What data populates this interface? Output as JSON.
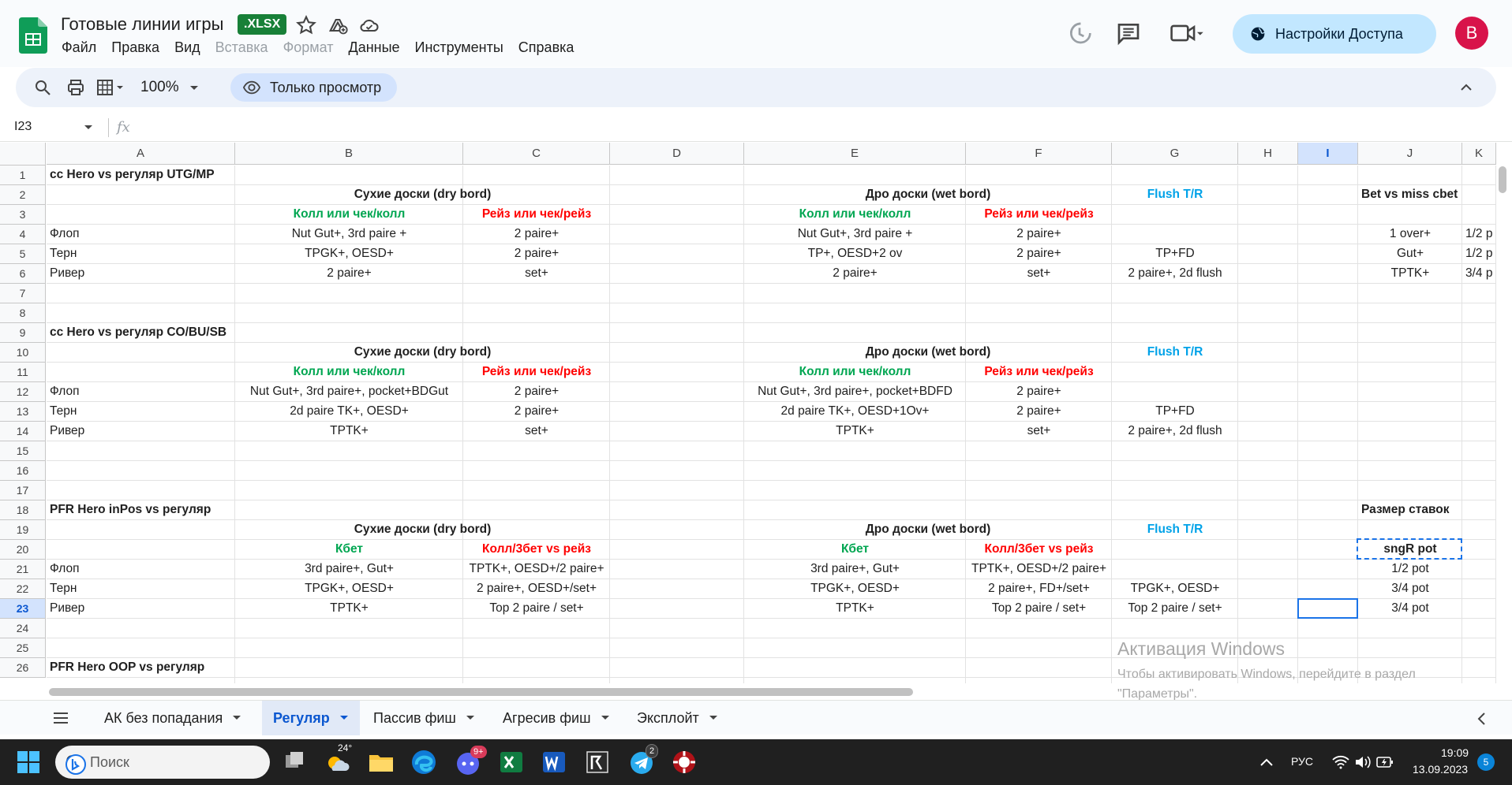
{
  "doc": {
    "title": "Готовые линии игры",
    "format_badge": ".XLSX"
  },
  "menu": [
    "Файл",
    "Правка",
    "Вид",
    "Вставка",
    "Формат",
    "Данные",
    "Инструменты",
    "Справка"
  ],
  "menu_disabled": [
    "Вставка",
    "Формат"
  ],
  "share_label": "Настройки Доступа",
  "avatar_letter": "B",
  "toolbar": {
    "zoom": "100%",
    "view_only": "Только просмотр"
  },
  "formula_bar": {
    "name_box": "I23",
    "fx_label": "fx"
  },
  "columns": [
    "A",
    "B",
    "C",
    "D",
    "E",
    "F",
    "G",
    "H",
    "I",
    "J",
    "K"
  ],
  "selected_column": "I",
  "rows": [
    "1",
    "2",
    "3",
    "4",
    "5",
    "6",
    "7",
    "8",
    "9",
    "10",
    "11",
    "12",
    "13",
    "14",
    "15",
    "16",
    "17",
    "18",
    "19",
    "20",
    "21",
    "22",
    "23",
    "24",
    "25",
    "26"
  ],
  "selected_row": "23",
  "cells": [
    {
      "ref": "A1",
      "text": "cc Hero vs регуляр UTG/MP",
      "style": "b"
    },
    {
      "ref": "B2",
      "text": "Сухие доски (dry bord)",
      "style": "b",
      "span": 2
    },
    {
      "ref": "E2",
      "text": "Дро доски (wet bord)",
      "style": "b",
      "span": 2
    },
    {
      "ref": "G2",
      "text": "Flush T/R",
      "style": "blue"
    },
    {
      "ref": "J2",
      "text": "Bet vs miss cbet",
      "style": "b",
      "align": "left"
    },
    {
      "ref": "B3",
      "text": "Колл или чек/колл",
      "style": "green"
    },
    {
      "ref": "C3",
      "text": "Рейз или чек/рейз",
      "style": "red"
    },
    {
      "ref": "E3",
      "text": "Колл или чек/колл",
      "style": "green"
    },
    {
      "ref": "F3",
      "text": "Рейз или чек/рейз",
      "style": "red"
    },
    {
      "ref": "A4",
      "text": "Флоп",
      "style": "",
      "align": "left"
    },
    {
      "ref": "B4",
      "text": "Nut Gut+, 3rd paire +"
    },
    {
      "ref": "C4",
      "text": "2 paire+"
    },
    {
      "ref": "E4",
      "text": "Nut Gut+, 3rd paire +"
    },
    {
      "ref": "F4",
      "text": "2 paire+"
    },
    {
      "ref": "J4",
      "text": "1 over+"
    },
    {
      "ref": "K4",
      "text": "1/2 р",
      "align": "left"
    },
    {
      "ref": "A5",
      "text": "Терн",
      "align": "left"
    },
    {
      "ref": "B5",
      "text": "TPGK+, OESD+"
    },
    {
      "ref": "C5",
      "text": "2 paire+"
    },
    {
      "ref": "E5",
      "text": "TP+, OESD+2 ov"
    },
    {
      "ref": "F5",
      "text": "2 paire+"
    },
    {
      "ref": "G5",
      "text": "TP+FD"
    },
    {
      "ref": "J5",
      "text": "Gut+"
    },
    {
      "ref": "K5",
      "text": "1/2 р",
      "align": "left"
    },
    {
      "ref": "A6",
      "text": "Ривер",
      "align": "left"
    },
    {
      "ref": "B6",
      "text": "2 paire+"
    },
    {
      "ref": "C6",
      "text": "set+"
    },
    {
      "ref": "E6",
      "text": "2 paire+"
    },
    {
      "ref": "F6",
      "text": "set+"
    },
    {
      "ref": "G6",
      "text": "2 paire+, 2d flush"
    },
    {
      "ref": "J6",
      "text": "TPTK+"
    },
    {
      "ref": "K6",
      "text": "3/4 р",
      "align": "left"
    },
    {
      "ref": "A9",
      "text": "cc Hero vs регуляр CO/BU/SB",
      "style": "b"
    },
    {
      "ref": "B10",
      "text": "Сухие доски (dry bord)",
      "style": "b",
      "span": 2
    },
    {
      "ref": "E10",
      "text": "Дро доски (wet bord)",
      "style": "b",
      "span": 2
    },
    {
      "ref": "G10",
      "text": "Flush T/R",
      "style": "blue"
    },
    {
      "ref": "B11",
      "text": "Колл или чек/колл",
      "style": "green"
    },
    {
      "ref": "C11",
      "text": "Рейз или чек/рейз",
      "style": "red"
    },
    {
      "ref": "E11",
      "text": "Колл или чек/колл",
      "style": "green"
    },
    {
      "ref": "F11",
      "text": "Рейз или чек/рейз",
      "style": "red"
    },
    {
      "ref": "A12",
      "text": "Флоп",
      "align": "left"
    },
    {
      "ref": "B12",
      "text": "Nut Gut+, 3rd paire+, pocket+BDGut"
    },
    {
      "ref": "C12",
      "text": "2 paire+"
    },
    {
      "ref": "E12",
      "text": "Nut Gut+, 3rd paire+, pocket+BDFD"
    },
    {
      "ref": "F12",
      "text": "2 paire+"
    },
    {
      "ref": "A13",
      "text": "Терн",
      "align": "left"
    },
    {
      "ref": "B13",
      "text": "2d paire TK+, OESD+"
    },
    {
      "ref": "C13",
      "text": "2 paire+"
    },
    {
      "ref": "E13",
      "text": "2d paire TK+, OESD+1Ov+"
    },
    {
      "ref": "F13",
      "text": "2 paire+"
    },
    {
      "ref": "G13",
      "text": "TP+FD"
    },
    {
      "ref": "A14",
      "text": "Ривер",
      "align": "left"
    },
    {
      "ref": "B14",
      "text": "TPTK+"
    },
    {
      "ref": "C14",
      "text": "set+"
    },
    {
      "ref": "E14",
      "text": "TPTK+"
    },
    {
      "ref": "F14",
      "text": "set+"
    },
    {
      "ref": "G14",
      "text": "2 paire+, 2d flush"
    },
    {
      "ref": "A18",
      "text": "PFR Hero inPos vs регуляр",
      "style": "b"
    },
    {
      "ref": "J18",
      "text": "Размер ставок",
      "style": "b",
      "align": "left"
    },
    {
      "ref": "B19",
      "text": "Сухие доски (dry bord)",
      "style": "b",
      "span": 2
    },
    {
      "ref": "E19",
      "text": "Дро доски (wet bord)",
      "style": "b",
      "span": 2
    },
    {
      "ref": "G19",
      "text": "Flush T/R",
      "style": "blue"
    },
    {
      "ref": "B20",
      "text": "Кбет",
      "style": "green"
    },
    {
      "ref": "C20",
      "text": "Колл/3бет vs рейз",
      "style": "red"
    },
    {
      "ref": "E20",
      "text": "Кбет",
      "style": "green"
    },
    {
      "ref": "F20",
      "text": "Колл/3бет vs рейз",
      "style": "red"
    },
    {
      "ref": "J20",
      "text": "sngR pot",
      "style": "b"
    },
    {
      "ref": "A21",
      "text": "Флоп",
      "align": "left"
    },
    {
      "ref": "B21",
      "text": "3rd paire+, Gut+"
    },
    {
      "ref": "C21",
      "text": "TPTK+, OESD+/2 paire+"
    },
    {
      "ref": "E21",
      "text": "3rd paire+, Gut+"
    },
    {
      "ref": "F21",
      "text": "TPTK+, OESD+/2 paire+"
    },
    {
      "ref": "J21",
      "text": "1/2 pot"
    },
    {
      "ref": "A22",
      "text": "Терн",
      "align": "left"
    },
    {
      "ref": "B22",
      "text": "TPGK+, OESD+"
    },
    {
      "ref": "C22",
      "text": "2 paire+, OESD+/set+"
    },
    {
      "ref": "E22",
      "text": "TPGK+, OESD+"
    },
    {
      "ref": "F22",
      "text": "2 paire+, FD+/set+"
    },
    {
      "ref": "G22",
      "text": "TPGK+, OESD+"
    },
    {
      "ref": "J22",
      "text": "3/4 pot"
    },
    {
      "ref": "A23",
      "text": "Ривер",
      "align": "left"
    },
    {
      "ref": "B23",
      "text": "TPTK+"
    },
    {
      "ref": "C23",
      "text": "Top 2 paire / set+"
    },
    {
      "ref": "E23",
      "text": "TPTK+"
    },
    {
      "ref": "F23",
      "text": "Top 2 paire / set+"
    },
    {
      "ref": "G23",
      "text": "Top 2 paire / set+"
    },
    {
      "ref": "J23",
      "text": "3/4 pot"
    },
    {
      "ref": "A26",
      "text": "PFR Hero OOP vs регуляр",
      "style": "b"
    }
  ],
  "watermark": {
    "title": "Активация Windows",
    "line1": "Чтобы активировать Windows, перейдите в раздел",
    "line2": "\"Параметры\"."
  },
  "sheet_tabs": [
    {
      "label": "АК без попадания",
      "active": false
    },
    {
      "label": "Регуляр",
      "active": true
    },
    {
      "label": "Пассив фиш",
      "active": false
    },
    {
      "label": "Агресив фиш",
      "active": false
    },
    {
      "label": "Эксплойт",
      "active": false
    }
  ],
  "taskbar": {
    "search_placeholder": "Поиск",
    "weather_temp": "24°",
    "discord_badge": "9+",
    "telegram_badge": "2",
    "lang": "РУС",
    "time": "19:09",
    "date": "13.09.2023",
    "notification_count": "5"
  }
}
